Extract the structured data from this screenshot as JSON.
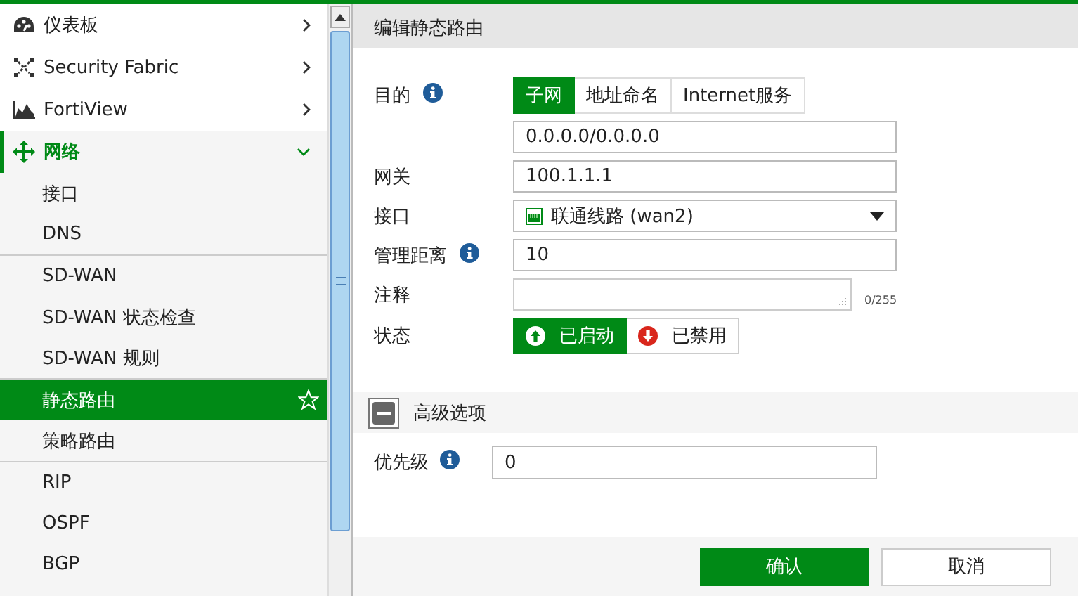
{
  "sidebar": {
    "items": [
      {
        "label": "仪表板",
        "expanded": false
      },
      {
        "label": "Security Fabric",
        "expanded": false
      },
      {
        "label": "FortiView",
        "expanded": false
      },
      {
        "label": "网络",
        "expanded": true,
        "sections": [
          {
            "children": [
              {
                "label": "接口",
                "selected": false
              },
              {
                "label": "DNS",
                "selected": false
              }
            ]
          },
          {
            "children": [
              {
                "label": "SD-WAN",
                "selected": false
              },
              {
                "label": "SD-WAN 状态检查",
                "selected": false
              },
              {
                "label": "SD-WAN 规则",
                "selected": false
              }
            ]
          },
          {
            "children": [
              {
                "label": "静态路由",
                "selected": true
              },
              {
                "label": "策略路由",
                "selected": false
              }
            ]
          },
          {
            "children": [
              {
                "label": "RIP",
                "selected": false
              },
              {
                "label": "OSPF",
                "selected": false
              },
              {
                "label": "BGP",
                "selected": false
              }
            ]
          }
        ]
      }
    ]
  },
  "panel": {
    "title": "编辑静态路由",
    "destination": {
      "label": "目的",
      "tabs": [
        {
          "label": "子网",
          "selected": true
        },
        {
          "label": "地址命名",
          "selected": false
        },
        {
          "label": "Internet服务",
          "selected": false
        }
      ],
      "value": "0.0.0.0/0.0.0.0"
    },
    "gateway": {
      "label": "网关",
      "value": "100.1.1.1"
    },
    "interface": {
      "label": "接口",
      "value": "联通线路 (wan2)"
    },
    "distance": {
      "label": "管理距离",
      "value": "10"
    },
    "comment": {
      "label": "注释",
      "counter": "0/255"
    },
    "status": {
      "label": "状态",
      "options": [
        {
          "label": "已启动",
          "selected": true
        },
        {
          "label": "已禁用",
          "selected": false
        }
      ]
    },
    "advanced": {
      "label": "高级选项",
      "expanded": true,
      "priority": {
        "label": "优先级",
        "value": "0"
      }
    },
    "buttons": [
      {
        "label": "确认",
        "kind": "primary"
      },
      {
        "label": "取消",
        "kind": "secondary"
      }
    ]
  }
}
